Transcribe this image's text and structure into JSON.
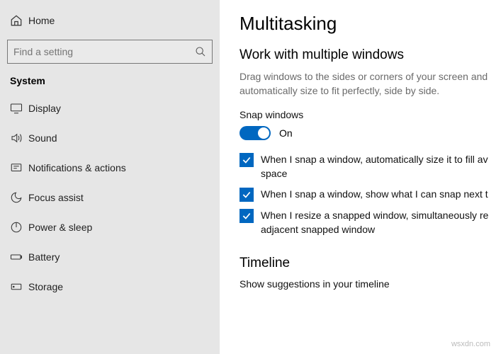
{
  "sidebar": {
    "home_label": "Home",
    "search_placeholder": "Find a setting",
    "section_label": "System",
    "items": [
      {
        "label": "Display"
      },
      {
        "label": "Sound"
      },
      {
        "label": "Notifications & actions"
      },
      {
        "label": "Focus assist"
      },
      {
        "label": "Power & sleep"
      },
      {
        "label": "Battery"
      },
      {
        "label": "Storage"
      }
    ]
  },
  "main": {
    "title": "Multitasking",
    "section1_heading": "Work with multiple windows",
    "section1_desc": "Drag windows to the sides or corners of your screen and automatically size to fit perfectly, side by side.",
    "snap_label": "Snap windows",
    "toggle_state": "On",
    "checks": [
      "When I snap a window, automatically size it to fill av space",
      "When I snap a window, show what I can snap next t",
      "When I resize a snapped window, simultaneously re adjacent snapped window"
    ],
    "section2_heading": "Timeline",
    "section2_desc": "Show suggestions in your timeline"
  },
  "watermark": "wsxdn.com",
  "colors": {
    "accent": "#0067c0"
  }
}
